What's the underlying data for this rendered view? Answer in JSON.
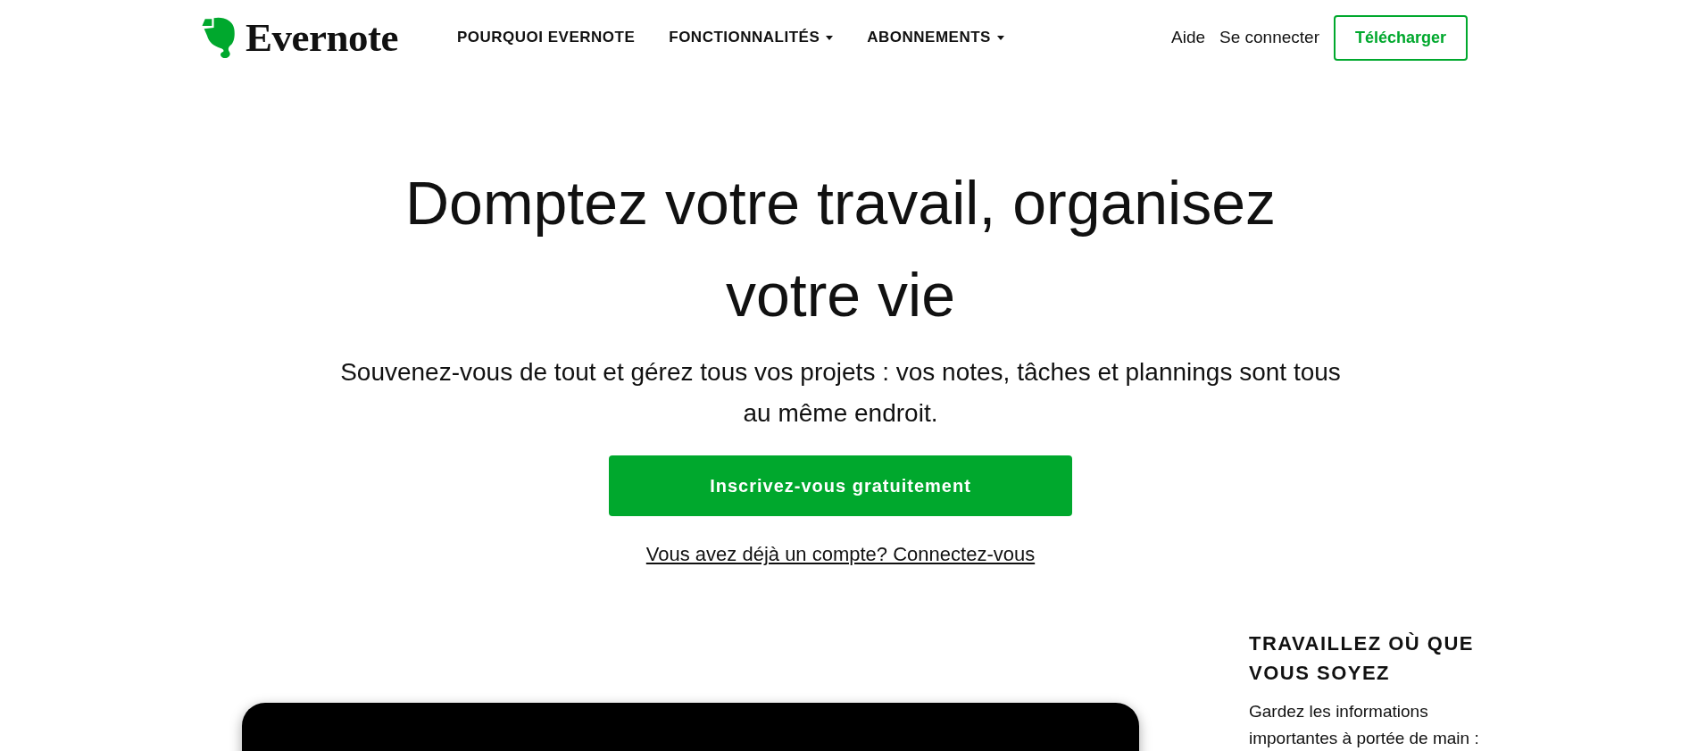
{
  "header": {
    "logo": "Evernote",
    "nav": [
      {
        "label": "POURQUOI EVERNOTE",
        "dropdown": false
      },
      {
        "label": "FONCTIONNALITÉS",
        "dropdown": true
      },
      {
        "label": "ABONNEMENTS",
        "dropdown": true
      }
    ],
    "links": [
      "Aide",
      "Se connecter"
    ],
    "download_button": "Télécharger"
  },
  "hero": {
    "title": "Domptez votre travail, organisez votre vie",
    "subtitle": "Souvenez-vous de tout et gérez tous vos projets : vos notes, tâches et plannings sont tous au même endroit.",
    "cta": "Inscrivez-vous gratuitement",
    "login_link": "Vous avez déjà un compte? Connectez-vous"
  },
  "feature": {
    "heading": "TRAVAILLEZ OÙ QUE VOUS SOYEZ",
    "text": "Gardez les informations importantes à portée de main :"
  }
}
